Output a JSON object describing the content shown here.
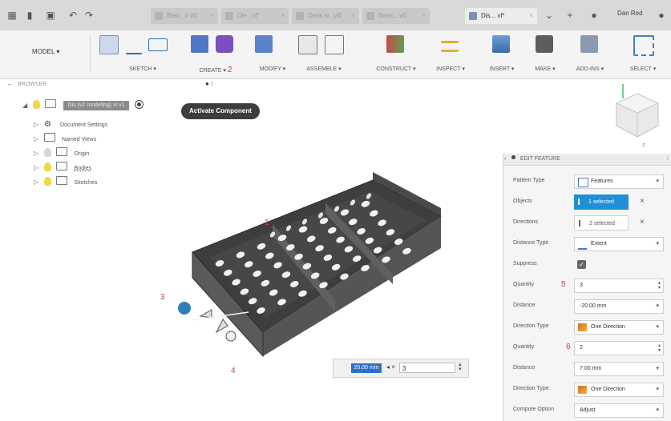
{
  "titlebar": {
    "tabs": [
      {
        "label": "Basi...d vl1"
      },
      {
        "label": "Die...vl*"
      },
      {
        "label": "Desk w...vl1"
      },
      {
        "label": "Basic...vl1"
      },
      {
        "label": "Dis... vl*"
      }
    ],
    "user": "Dan Red"
  },
  "ribbon": {
    "workspace": "MODEL ▾",
    "groups": [
      {
        "label": "SKETCH ▾"
      },
      {
        "label": "CREATE ▾"
      },
      {
        "label": "MODIFY ▾"
      },
      {
        "label": "ASSEMBLE ▾"
      },
      {
        "label": "CONSTRUCT ▾"
      },
      {
        "label": "INSPECT ▾"
      },
      {
        "label": "INSERT ▾"
      },
      {
        "label": "MAKE ▾"
      },
      {
        "label": "ADD-INS ▾"
      },
      {
        "label": "SELECT ▾"
      }
    ],
    "annotation_2": "2"
  },
  "browser": {
    "header": "BROWSER",
    "root_label": "Dis (v2 modeling) vl v1",
    "items": [
      {
        "label": "Document Settings"
      },
      {
        "label": "Named Views"
      },
      {
        "label": "Origin"
      },
      {
        "label": "Bodies"
      },
      {
        "label": "Sketches"
      }
    ],
    "tooltip": "Activate Component"
  },
  "viewport": {
    "annotations": {
      "n1": "1",
      "n3": "3",
      "n4": "4"
    },
    "dim_value": "20.00 mm",
    "dim_qty": "3"
  },
  "panel": {
    "title": "EDIT FEATURE",
    "rows": [
      {
        "label": "Pattern Type",
        "value": "Features"
      },
      {
        "label": "Objects",
        "value": "1 selected"
      },
      {
        "label": "Directions",
        "value": "2 selected"
      },
      {
        "label": "Distance Type",
        "value": "Extent"
      },
      {
        "label": "Suppress",
        "value": ""
      },
      {
        "label": "Quantity",
        "value": "3"
      },
      {
        "label": "Distance",
        "value": "-20.00 mm"
      },
      {
        "label": "Direction Type",
        "value": "One Direction"
      },
      {
        "label": "Quantity",
        "value": "2"
      },
      {
        "label": "Distance",
        "value": "7.00 mm"
      },
      {
        "label": "Direction Type",
        "value": "One Direction"
      },
      {
        "label": "Compute Option",
        "value": "Adjust"
      }
    ],
    "annotation_5": "5",
    "annotation_6": "6"
  },
  "colors": {
    "accent": "#1f8fd8",
    "annotation": "#d23a3a",
    "model": "#4a4a4a"
  }
}
